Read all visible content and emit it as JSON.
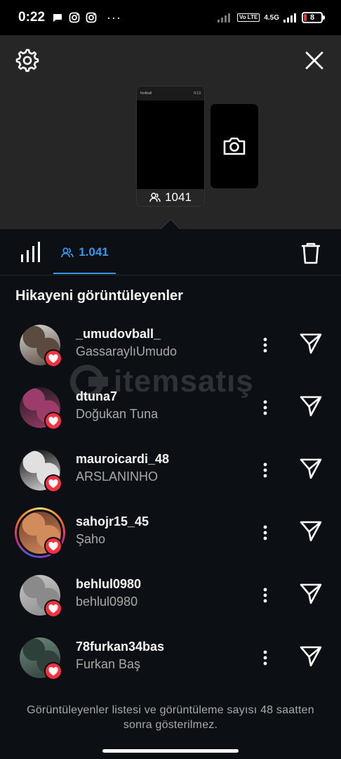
{
  "status_bar": {
    "time": "0:22",
    "more": "···",
    "volte": "Vo LTE",
    "network": "4.5G",
    "battery": "8"
  },
  "preview": {
    "thumb_username": "football",
    "thumb_time": "0:13",
    "view_count": "1041"
  },
  "tabs": {
    "viewers_count": "1.041"
  },
  "section_title": "Hikayeni görüntüleyenler",
  "viewers": [
    {
      "username": "_umudovball_",
      "name": "GassaraylıUmudo",
      "ring": false,
      "avatar_colors": [
        "#d9d9d9",
        "#5b4a3f"
      ]
    },
    {
      "username": "dtuna7",
      "name": "Doğukan Tuna",
      "ring": false,
      "avatar_colors": [
        "#1a1a1a",
        "#9c3c6a"
      ]
    },
    {
      "username": "mauroicardi_48",
      "name": "ARSLANINHO",
      "ring": false,
      "avatar_colors": [
        "#050505",
        "#e0e0e0"
      ]
    },
    {
      "username": "sahojr15_45",
      "name": "Şaho",
      "ring": true,
      "avatar_colors": [
        "#6b3b2a",
        "#d28c5c"
      ]
    },
    {
      "username": "behlul0980",
      "name": "behlul0980",
      "ring": false,
      "avatar_colors": [
        "#c9c9c9",
        "#8a8a8a"
      ]
    },
    {
      "username": "78furkan34bas",
      "name": "Furkan Baş",
      "ring": false,
      "avatar_colors": [
        "#6f8a7a",
        "#2f3f3a"
      ]
    }
  ],
  "footer_note": "Görüntüleyenler listesi ve görüntüleme sayısı 48 saatten sonra gösterilmez.",
  "watermark": "itemsatış",
  "colors": {
    "accent": "#3797f0",
    "like": "#ff3040",
    "background": "#0c1014",
    "preview_bg": "#262626"
  }
}
